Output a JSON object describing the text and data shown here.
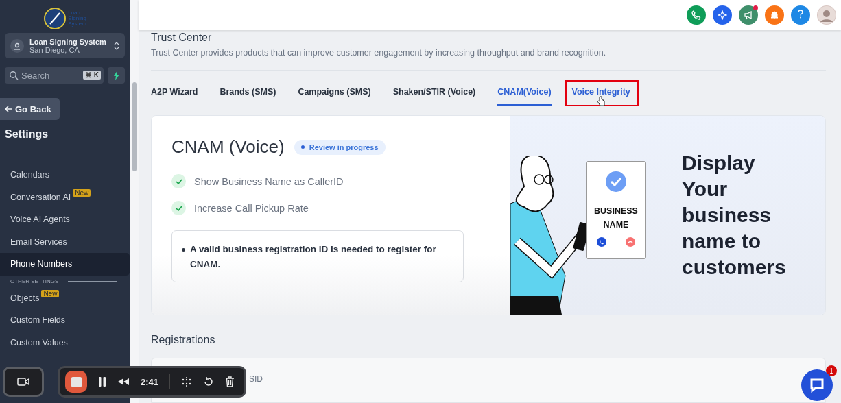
{
  "sidebar": {
    "logo_text": [
      "Loan",
      "Signing",
      "System"
    ],
    "account": {
      "name": "Loan Signing System",
      "location": "San Diego, CA"
    },
    "search": {
      "placeholder": "Search",
      "shortcut": "⌘ K"
    },
    "back_button": "Go Back",
    "heading": "Settings",
    "items": [
      {
        "label": "Calendars",
        "selected": false
      },
      {
        "label": "Conversation AI",
        "badge": "New",
        "selected": false
      },
      {
        "label": "Voice AI Agents",
        "selected": false
      },
      {
        "label": "Email Services",
        "selected": false
      },
      {
        "label": "Phone Numbers",
        "selected": true
      }
    ],
    "section_label": "OTHER SETTINGS",
    "other_items": [
      {
        "label": "Objects",
        "badge": "New",
        "selected": false
      },
      {
        "label": "Custom Fields",
        "selected": false
      },
      {
        "label": "Custom Values",
        "selected": false
      }
    ]
  },
  "header_icons": [
    {
      "kind": "phone",
      "color": "#0f9d58"
    },
    {
      "kind": "sparkle",
      "color": "#2563eb"
    },
    {
      "kind": "megaphone",
      "color": "#3f8f6b",
      "dot": true
    },
    {
      "kind": "bell",
      "color": "#f97316"
    },
    {
      "kind": "help",
      "color": "#1e88e5"
    },
    {
      "kind": "avatar",
      "color": "#d9c8c4"
    }
  ],
  "page": {
    "title": "Trust Center",
    "description": "Trust Center provides products that can improve customer engagement by increasing throughput and brand recognition.",
    "tabs": [
      {
        "label": "A2P Wizard",
        "selected": false,
        "highlighted": false
      },
      {
        "label": "Brands (SMS)",
        "selected": false,
        "highlighted": false
      },
      {
        "label": "Campaigns (SMS)",
        "selected": false,
        "highlighted": false
      },
      {
        "label": "Shaken/STIR (Voice)",
        "selected": false,
        "highlighted": false
      },
      {
        "label": "CNAM(Voice)",
        "selected": true,
        "highlighted": false
      },
      {
        "label": "Voice Integrity",
        "selected": false,
        "highlighted": true
      }
    ],
    "card": {
      "title": "CNAM (Voice)",
      "status": "Review in progress",
      "features": [
        "Show Business Name as CallerID",
        "Increase Call Pickup Rate"
      ],
      "note": "A valid business registration ID is needed to register for CNAM.",
      "phone_label": "BUSINESS NAME",
      "headline": "Display Your business name to customers"
    },
    "registrations": {
      "heading": "Registrations",
      "column_1": "SID"
    }
  },
  "recorder": {
    "time": "2:41"
  },
  "chat": {
    "badge": "1"
  }
}
